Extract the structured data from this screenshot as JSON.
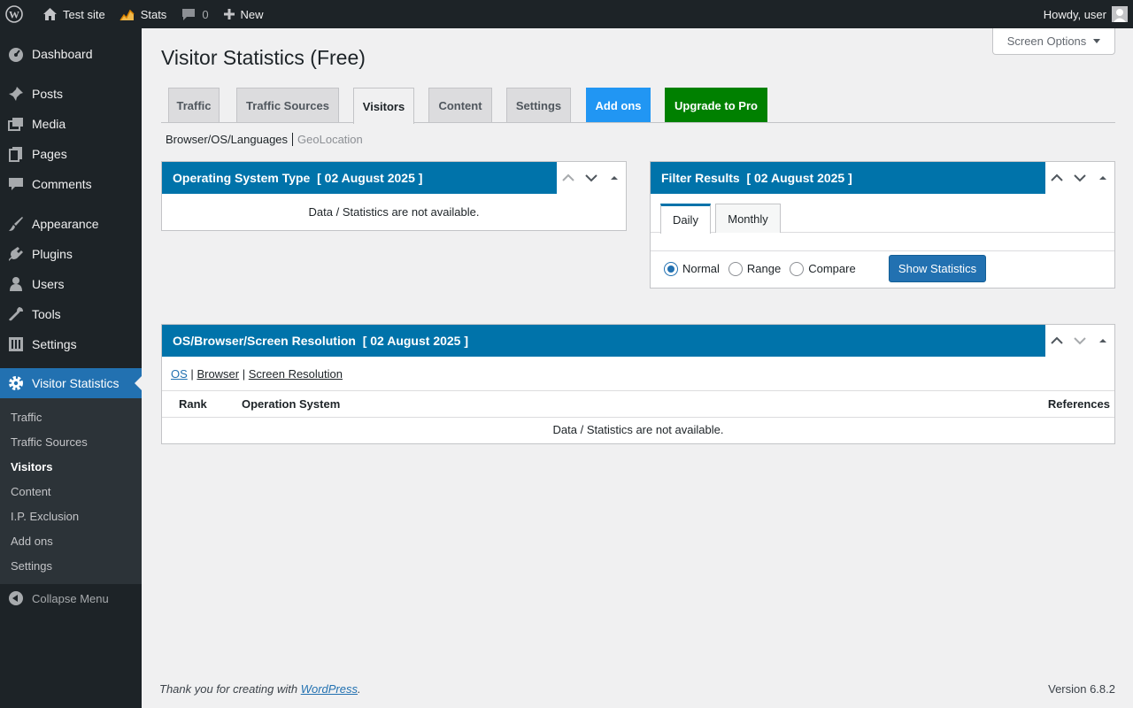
{
  "adminbar": {
    "site_name": "Test site",
    "stats_label": "Stats",
    "comments_count": "0",
    "new_label": "New",
    "howdy": "Howdy, user"
  },
  "sidebar": {
    "items": [
      {
        "label": "Dashboard",
        "icon": "dashboard-icon"
      },
      {
        "label": "Posts",
        "icon": "pin-icon"
      },
      {
        "label": "Media",
        "icon": "media-icon"
      },
      {
        "label": "Pages",
        "icon": "pages-icon"
      },
      {
        "label": "Comments",
        "icon": "comment-icon"
      },
      {
        "label": "Appearance",
        "icon": "brush-icon"
      },
      {
        "label": "Plugins",
        "icon": "plugin-icon"
      },
      {
        "label": "Users",
        "icon": "user-icon"
      },
      {
        "label": "Tools",
        "icon": "wrench-icon"
      },
      {
        "label": "Settings",
        "icon": "settings-icon"
      },
      {
        "label": "Visitor Statistics",
        "icon": "gear-icon"
      }
    ],
    "submenu": [
      "Traffic",
      "Traffic Sources",
      "Visitors",
      "Content",
      "I.P. Exclusion",
      "Add ons",
      "Settings"
    ],
    "collapse_label": "Collapse Menu"
  },
  "main": {
    "screen_options": "Screen Options",
    "title": "Visitor Statistics (Free)",
    "tabs": [
      "Traffic",
      "Traffic Sources",
      "Visitors",
      "Content",
      "Settings",
      "Add ons",
      "Upgrade to Pro"
    ],
    "subnav": {
      "current": "Browser/OS/Languages",
      "other": "GeoLocation"
    }
  },
  "os_box": {
    "title": "Operating System Type  [ 02 August 2025 ]",
    "empty": "Data / Statistics are not available."
  },
  "filter_box": {
    "title": "Filter Results  [ 02 August 2025 ]",
    "tabs": [
      "Daily",
      "Monthly"
    ],
    "radios": [
      "Normal",
      "Range",
      "Compare"
    ],
    "selected_radio": "Normal",
    "button": "Show Statistics"
  },
  "resolution_box": {
    "title": "OS/Browser/Screen Resolution  [ 02 August 2025 ]",
    "links": [
      "OS",
      "Browser",
      "Screen Resolution"
    ],
    "separator": "|",
    "columns": [
      "Rank",
      "Operation System",
      "References"
    ],
    "empty": "Data / Statistics are not available."
  },
  "footer": {
    "thanks": "Thank you for creating with",
    "link": "WordPress",
    "period": ".",
    "version": "Version 6.8.2"
  },
  "colors": {
    "accent": "#2271b1",
    "box_header": "#0073aa",
    "addons_tab": "#2196f3",
    "pro_tab": "#008000",
    "admin_dark": "#1d2327"
  }
}
